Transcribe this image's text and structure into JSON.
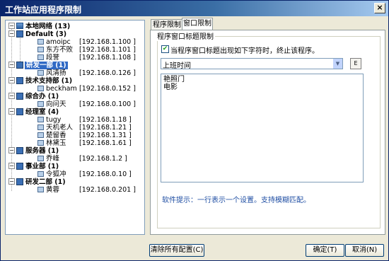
{
  "window": {
    "title": "工作站应用程序限制",
    "close_label": "×"
  },
  "tree": {
    "root": "本地网络 (13)",
    "groups": [
      {
        "label": "Default (3)",
        "items": [
          {
            "name": "amoipc",
            "ip": "[192.168.1.100 ]"
          },
          {
            "name": "东方不败",
            "ip": "[192.168.1.101 ]"
          },
          {
            "name": "段誉",
            "ip": "[192.168.1.108 ]"
          }
        ]
      },
      {
        "label": "研发一部 (1)",
        "items": [
          {
            "name": "风清扬",
            "ip": "[192.168.0.126 ]"
          }
        ]
      },
      {
        "label": "技术支持部 (1)",
        "items": [
          {
            "name": "beckham",
            "ip": "[192.168.0.152 ]"
          }
        ]
      },
      {
        "label": "综合办 (1)",
        "items": [
          {
            "name": "向问天",
            "ip": "[192.168.0.100 ]"
          }
        ]
      },
      {
        "label": "经理室 (4)",
        "items": [
          {
            "name": "tugy",
            "ip": "[192.168.1.18 ]"
          },
          {
            "name": "天机老人",
            "ip": "[192.168.1.21 ]"
          },
          {
            "name": "楚留香",
            "ip": "[192.168.1.31 ]"
          },
          {
            "name": "林黛玉",
            "ip": "[192.168.1.61 ]"
          }
        ]
      },
      {
        "label": "服务器 (1)",
        "items": [
          {
            "name": "乔峰",
            "ip": "[192.168.1.2 ]"
          }
        ]
      },
      {
        "label": "事业部 (1)",
        "items": [
          {
            "name": "令狐冲",
            "ip": "[192.168.0.10 ]"
          }
        ]
      },
      {
        "label": "研发二部 (1)",
        "items": [
          {
            "name": "黄蓉",
            "ip": "[192.168.0.201 ]"
          }
        ]
      }
    ]
  },
  "tabs": [
    {
      "label": "程序限制"
    },
    {
      "label": "窗口限制"
    }
  ],
  "panel": {
    "legend": "程序窗口标题限制",
    "checkbox_label": "当程序窗口标题出现如下字符时，终止该程序。",
    "checkbox_checked": "✔",
    "combo_value": "上班时间",
    "combo_arrow": "▼",
    "edit_button": "E",
    "textarea_lines": [
      "艳照门",
      "电影"
    ],
    "hint": "软件提示：一行表示一个设置。支持模糊匹配。"
  },
  "buttons": {
    "clear": "清除所有配置(C)",
    "ok": "确定(T)",
    "cancel": "取消(N)"
  }
}
